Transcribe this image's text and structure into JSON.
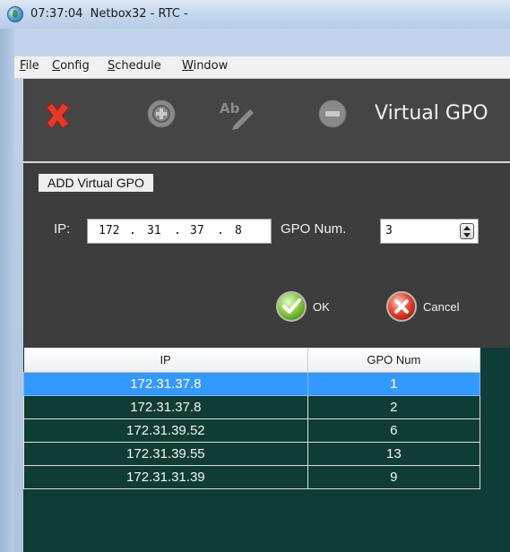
{
  "window": {
    "title": "07:37:04  Netbox32 - RTC -"
  },
  "menubar": {
    "file": "File",
    "config": "Config",
    "schedule": "Schedule",
    "window": "Window"
  },
  "toolbar": {
    "heading": "Virtual GPO",
    "icons": [
      "close-icon",
      "add-icon",
      "rename-icon",
      "remove-icon"
    ]
  },
  "form": {
    "section_title": "ADD Virtual GPO",
    "ip_label": "IP:",
    "ip_octets": [
      "172",
      "31",
      "37",
      "8"
    ],
    "gpo_label": "GPO Num.",
    "gpo_value": "3",
    "ok_label": "OK",
    "cancel_label": "Cancel"
  },
  "table": {
    "columns": [
      "IP",
      "GPO Num"
    ],
    "rows": [
      {
        "ip": "172.31.37.8",
        "gpo": "1",
        "selected": true
      },
      {
        "ip": "172.31.37.8",
        "gpo": "2",
        "selected": false
      },
      {
        "ip": "172.31.39.52",
        "gpo": "6",
        "selected": false
      },
      {
        "ip": "172.31.39.55",
        "gpo": "13",
        "selected": false
      },
      {
        "ip": "172.31.31.39",
        "gpo": "9",
        "selected": false
      }
    ]
  },
  "colors": {
    "panel": "#3d3d3d",
    "table_bg": "#0f3d36",
    "selection": "#3399ff"
  }
}
